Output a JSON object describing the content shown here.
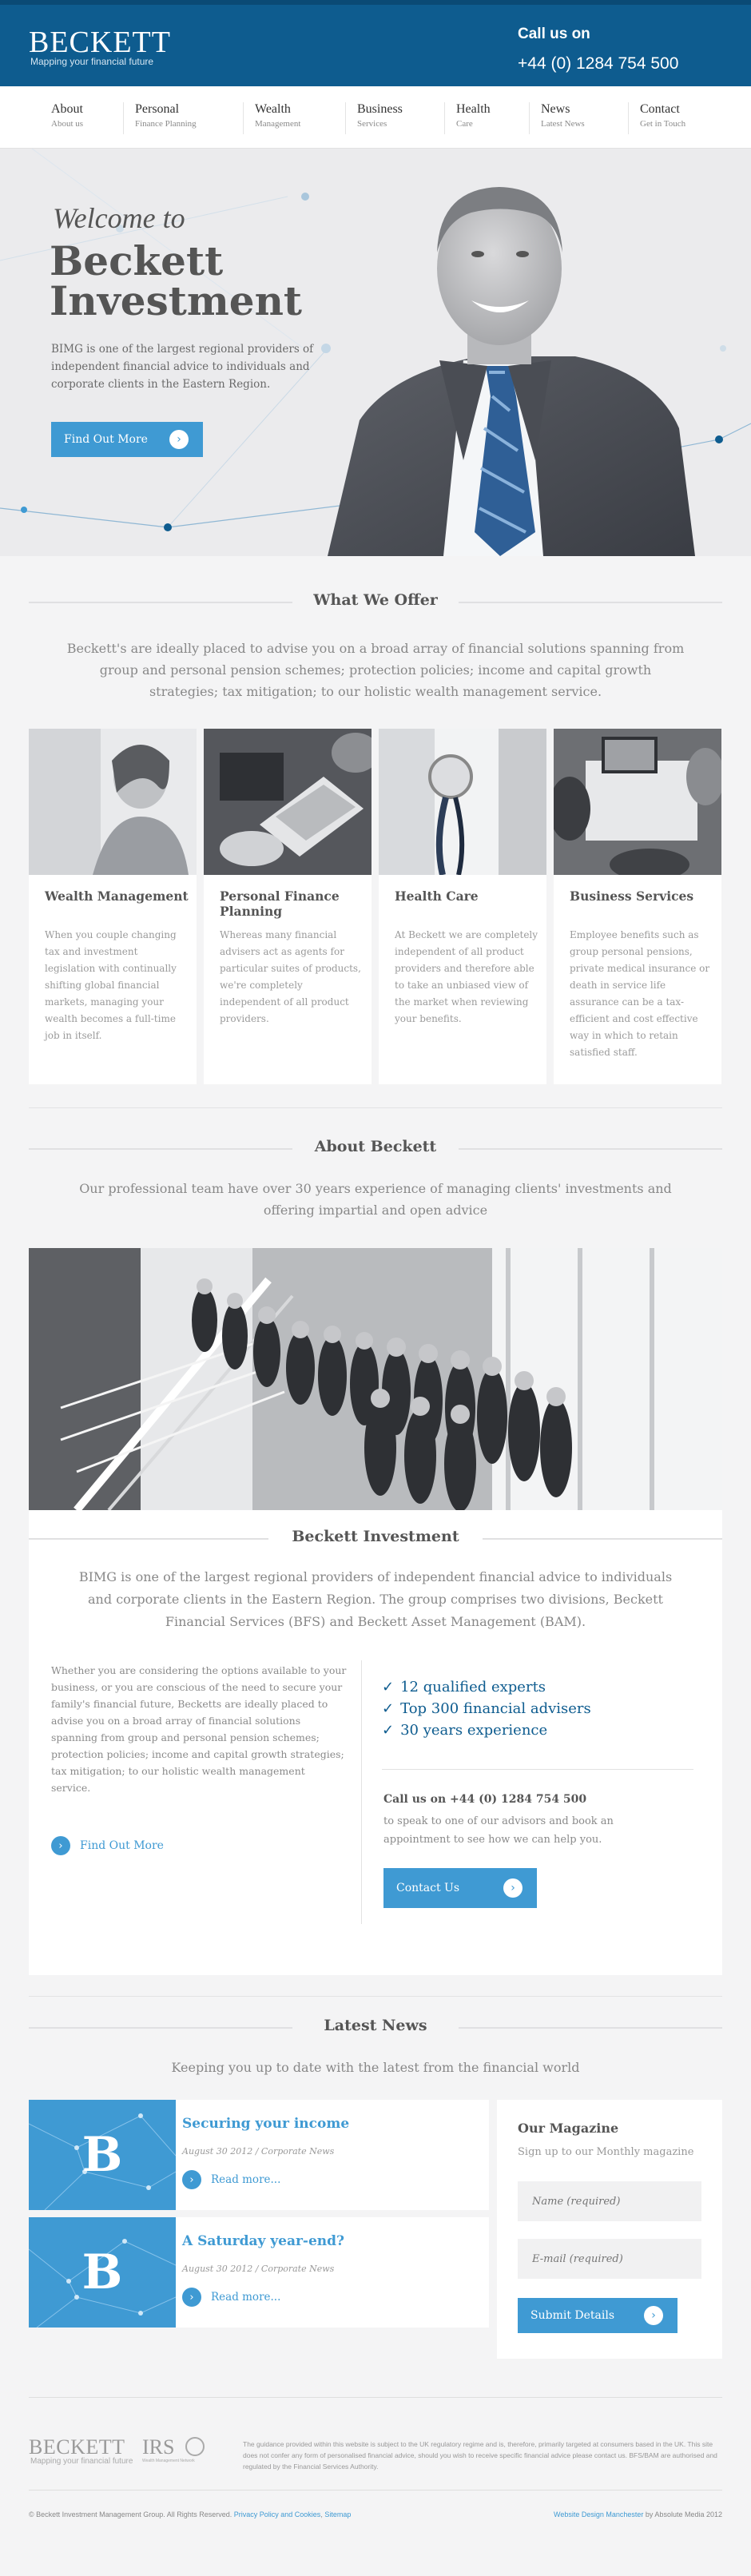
{
  "header": {
    "logo": "BECKETT",
    "tagline": "Mapping your financial future",
    "call_label": "Call us on",
    "phone": "+44 (0) 1284 754 500"
  },
  "nav": [
    {
      "title": "About",
      "sub": "About us"
    },
    {
      "title": "Personal",
      "sub": "Finance Planning"
    },
    {
      "title": "Wealth",
      "sub": "Management"
    },
    {
      "title": "Business",
      "sub": "Services"
    },
    {
      "title": "Health",
      "sub": "Care"
    },
    {
      "title": "News",
      "sub": "Latest News"
    },
    {
      "title": "Contact",
      "sub": "Get in Touch"
    }
  ],
  "hero": {
    "welcome": "Welcome to",
    "name": "Beckett Investment",
    "text": "BIMG is one of the largest regional providers of independent financial advice to individuals and corporate clients in the Eastern Region.",
    "button": "Find Out More",
    "arrow": "›"
  },
  "offer": {
    "heading": "What We Offer",
    "intro": "Beckett's are ideally placed to advise you on a broad array of financial solutions spanning from group and personal pension schemes; protection policies; income and capital growth strategies; tax mitigation; to our holistic wealth management service.",
    "cards": [
      {
        "title": "Wealth Management",
        "text": "When you couple changing tax and investment legislation with continually shifting global financial markets, managing your wealth becomes a full-time job in itself."
      },
      {
        "title": "Personal Finance Planning",
        "text": "Whereas many financial advisers act as agents for particular suites of products, we're completely independent of all product providers."
      },
      {
        "title": "Health Care",
        "text": "At Beckett we are completely independent of all product providers and therefore able to take an unbiased view of the market when reviewing your benefits."
      },
      {
        "title": "Business Services",
        "text": "Employee benefits such as group personal pensions, private medical insurance or death in service life assurance can be a tax-efficient and cost effective way in which to retain satisfied staff."
      }
    ]
  },
  "about": {
    "heading": "About Beckett",
    "intro": "Our professional team have over 30 years experience of managing clients' investments and offering impartial and open advice",
    "sub_heading": "Beckett Investment",
    "sub_intro": "BIMG is one of the largest regional providers of independent financial advice to individuals and corporate clients in the Eastern Region. The group comprises two divisions, Beckett Financial Services (BFS) and Beckett Asset Management (BAM).",
    "body": "Whether you are considering the options available to your business, or you are conscious of the need to secure your family's financial future, Becketts are ideally placed to advise you on a broad array of financial solutions spanning from group and personal pension schemes; protection policies; income and capital growth strategies; tax mitigation; to our holistic wealth management service.",
    "find_more": "Find Out More",
    "bullets": [
      "12 qualified experts",
      "Top 300 financial advisers",
      "30 years experience"
    ],
    "check": "✓",
    "call_title": "Call us on +44 (0) 1284 754 500",
    "call_text": "to speak to one of our advisors and book an appointment to see how we can help you.",
    "contact_button": "Contact Us"
  },
  "news": {
    "heading": "Latest News",
    "intro": "Keeping you up to date with the latest from the financial world",
    "items": [
      {
        "letter": "B",
        "title": "Securing your income",
        "meta": "August 30 2012 / Corporate News",
        "read": "Read more..."
      },
      {
        "letter": "B",
        "title": "A Saturday year-end?",
        "meta": "August 30 2012 / Corporate News",
        "read": "Read more..."
      }
    ],
    "magazine": {
      "title": "Our Magazine",
      "sub": "Sign up to our Monthly magazine",
      "name_placeholder": "Name (required)",
      "email_placeholder": "E-mail (required)",
      "button": "Submit Details"
    }
  },
  "footer": {
    "logo": "BECKETT",
    "tagline": "Mapping your financial future",
    "irs": "IRS",
    "irs_sub": "Wealth Management Network",
    "disclaimer": "The guidance provided within this website is subject to the UK regulatory regime and is, therefore, primarily targeted at consumers based in the UK. This site does not confer any form of personalised financial advice, should you wish to receive specific financial advice please contact us. BFS/BAM are authorised and regulated by the Financial Services Authority.",
    "copyright": "© Beckett Investment Management Group. All Rights Reserved.",
    "privacy": "Privacy Policy and Cookies",
    "sitemap": "Sitemap",
    "design_link": "Website Design Manchester",
    "design_by": "by Absolute Media 2012"
  },
  "colors": {
    "header": "#0e5c8f",
    "accent": "#3f9ad3",
    "background": "#f4f4f5"
  }
}
